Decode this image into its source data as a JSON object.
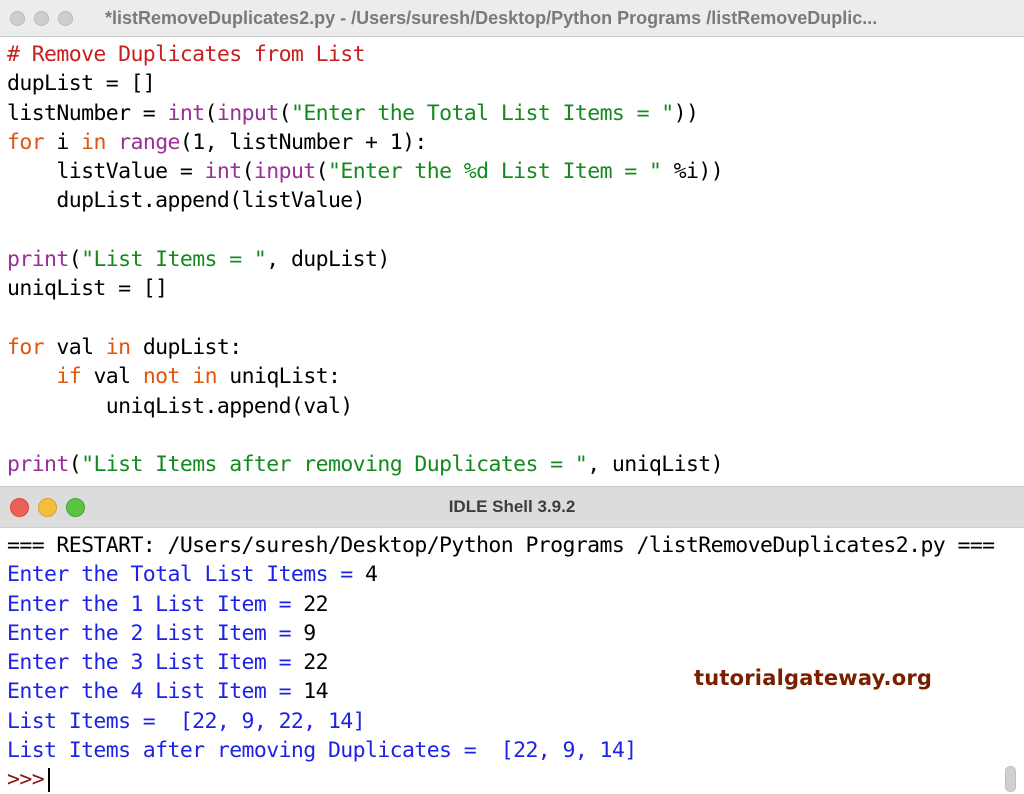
{
  "editor_window": {
    "title": "*listRemoveDuplicates2.py - /Users/suresh/Desktop/Python Programs /listRemoveDuplic..."
  },
  "code": {
    "l1": "# Remove Duplicates from List",
    "l2a": "dupList = ",
    "l2b": "[]",
    "l3a": "listNumber = ",
    "l3b": "int",
    "l3c": "(",
    "l3d": "input",
    "l3e": "(",
    "l3f": "\"Enter the Total List Items = \"",
    "l3g": "))",
    "l4a": "for",
    "l4b": " i ",
    "l4c": "in",
    "l4d": " ",
    "l4e": "range",
    "l4f": "(1, listNumber + 1):",
    "l5a": "    listValue = ",
    "l5b": "int",
    "l5c": "(",
    "l5d": "input",
    "l5e": "(",
    "l5f": "\"Enter the %d List Item = \"",
    "l5g": " %i))",
    "l6": "    dupList.append(listValue)",
    "l8a": "print",
    "l8b": "(",
    "l8c": "\"List Items = \"",
    "l8d": ", dupList)",
    "l9a": "uniqList = ",
    "l9b": "[]",
    "l11a": "for",
    "l11b": " val ",
    "l11c": "in",
    "l11d": " dupList:",
    "l12a": "    ",
    "l12b": "if",
    "l12c": " val ",
    "l12d": "not",
    "l12e": " ",
    "l12f": "in",
    "l12g": " uniqList:",
    "l13": "        uniqList.append(val)",
    "l15a": "print",
    "l15b": "(",
    "l15c": "\"List Items after removing Duplicates = \"",
    "l15d": ", uniqList)"
  },
  "shell_window": {
    "title": "IDLE Shell 3.9.2"
  },
  "shell": {
    "restart": "=== RESTART: /Users/suresh/Desktop/Python Programs /listRemoveDuplicates2.py ===",
    "r1a": "Enter the Total List Items = ",
    "r1b": "4",
    "r2a": "Enter the 1 List Item = ",
    "r2b": "22",
    "r3a": "Enter the 2 List Item = ",
    "r3b": "9",
    "r4a": "Enter the 3 List Item = ",
    "r4b": "22",
    "r5a": "Enter the 4 List Item = ",
    "r5b": "14",
    "r6": "List Items =  [22, 9, 22, 14]",
    "r7": "List Items after removing Duplicates =  [22, 9, 14]",
    "prompt": ">>>"
  },
  "watermark": "tutorialgateway.org",
  "colors": {
    "comment": "#c81f1f",
    "keyword": "#e0560e",
    "builtin": "#9a2f95",
    "string": "#138a1d",
    "output": "#1e22e6"
  }
}
